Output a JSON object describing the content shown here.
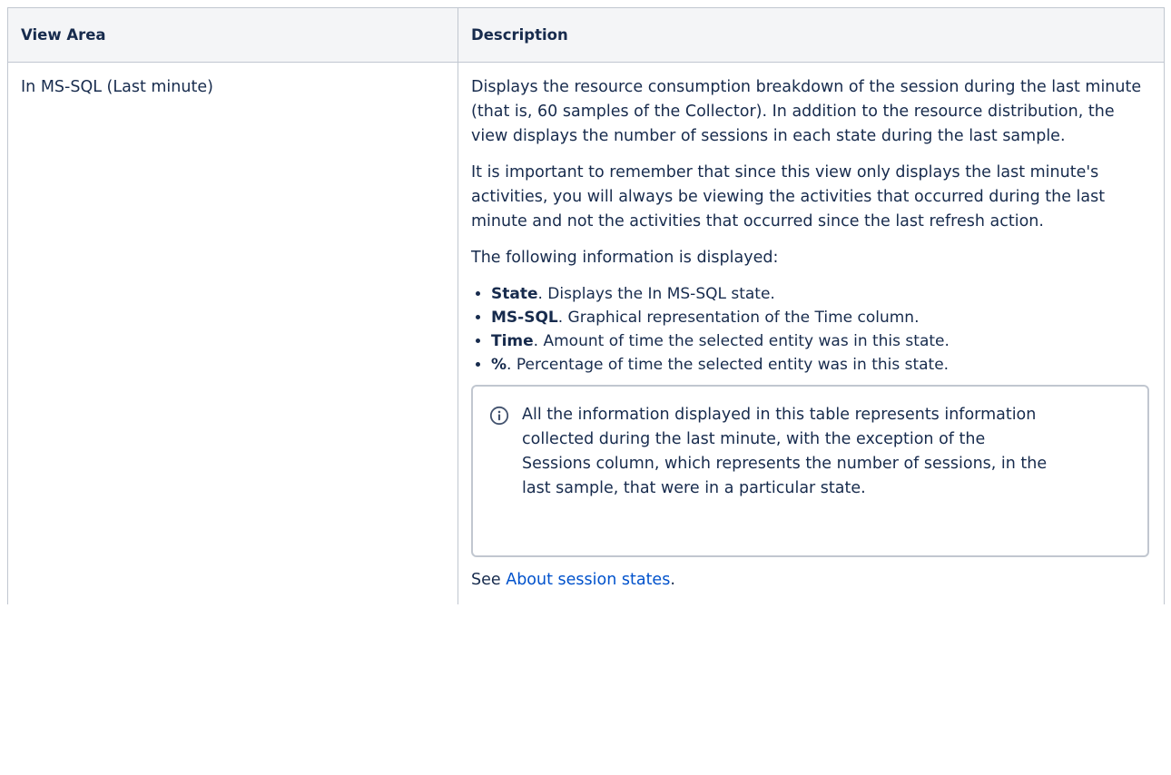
{
  "table": {
    "headers": [
      "View Area",
      "Description"
    ],
    "row": {
      "view_area": "In MS-SQL (Last minute)",
      "paragraphs": [
        "Displays the resource consumption breakdown of the session during the last minute (that is, 60 samples of the Collector). In addition to the resource distribution, the view displays the number of sessions in each state during the last sample.",
        "It is important to remember that since this view only displays the last minute's activities, you will always be viewing the activities that occurred during the last minute and not the activities that occurred since the last refresh action.",
        "The following information is displayed:"
      ],
      "items": [
        {
          "term": "State",
          "text": ". Displays the In MS-SQL state."
        },
        {
          "term": "MS-SQL",
          "text": ". Graphical representation of the Time column."
        },
        {
          "term": "Time",
          "text": ". Amount of time the selected entity was in this state."
        },
        {
          "term": "%",
          "text": ". Percentage of time the selected entity was in this state."
        }
      ],
      "info_panel": {
        "icon": "info-icon",
        "text": "All the information displayed in this table represents information collected during the last minute, with the exception of the Sessions column, which represents the number of sessions, in the last sample, that were in a particular state."
      },
      "see_also": {
        "prefix": "See ",
        "link_text": "About session states",
        "suffix": "."
      }
    }
  },
  "colors": {
    "header_bg": "#f4f5f7",
    "border": "#c1c7d0",
    "text": "#172b4d",
    "link": "#0052cc"
  }
}
